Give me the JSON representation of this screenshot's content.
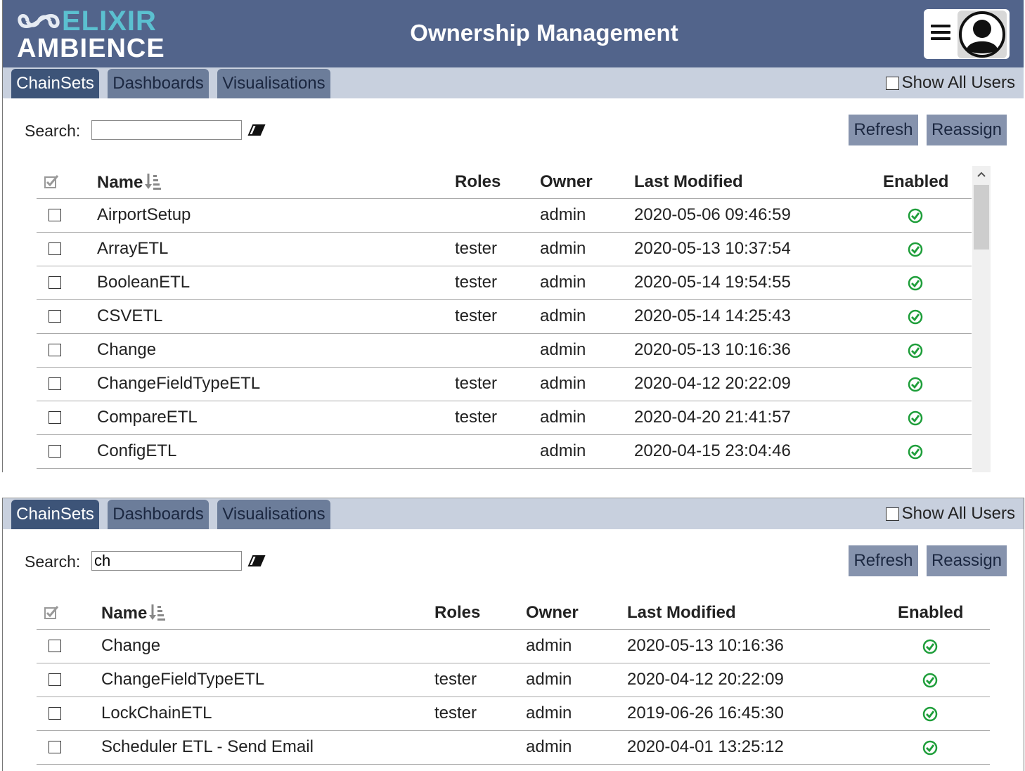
{
  "app": {
    "logo_top": "ELIXIR",
    "logo_bottom": "AMBIENCE",
    "title": "Ownership Management"
  },
  "views": [
    {
      "tabs": [
        "ChainSets",
        "Dashboards",
        "Visualisations"
      ],
      "active_tab": "ChainSets",
      "show_all_users_label": "Show All Users",
      "show_all_users_checked": false,
      "search_label": "Search:",
      "search_value": "",
      "refresh_label": "Refresh",
      "reassign_label": "Reassign",
      "columns": {
        "name": "Name",
        "roles": "Roles",
        "owner": "Owner",
        "last_modified": "Last Modified",
        "enabled": "Enabled"
      },
      "rows": [
        {
          "name": "AirportSetup",
          "roles": "",
          "owner": "admin",
          "last_modified": "2020-05-06 09:46:59",
          "enabled": true
        },
        {
          "name": "ArrayETL",
          "roles": "tester",
          "owner": "admin",
          "last_modified": "2020-05-13 10:37:54",
          "enabled": true
        },
        {
          "name": "BooleanETL",
          "roles": "tester",
          "owner": "admin",
          "last_modified": "2020-05-14 19:54:55",
          "enabled": true
        },
        {
          "name": "CSVETL",
          "roles": "tester",
          "owner": "admin",
          "last_modified": "2020-05-14 14:25:43",
          "enabled": true
        },
        {
          "name": "Change",
          "roles": "",
          "owner": "admin",
          "last_modified": "2020-05-13 10:16:36",
          "enabled": true
        },
        {
          "name": "ChangeFieldTypeETL",
          "roles": "tester",
          "owner": "admin",
          "last_modified": "2020-04-12 20:22:09",
          "enabled": true
        },
        {
          "name": "CompareETL",
          "roles": "tester",
          "owner": "admin",
          "last_modified": "2020-04-20 21:41:57",
          "enabled": true
        },
        {
          "name": "ConfigETL",
          "roles": "",
          "owner": "admin",
          "last_modified": "2020-04-15 23:04:46",
          "enabled": true
        }
      ]
    },
    {
      "tabs": [
        "ChainSets",
        "Dashboards",
        "Visualisations"
      ],
      "active_tab": "ChainSets",
      "show_all_users_label": "Show All Users",
      "show_all_users_checked": false,
      "search_label": "Search:",
      "search_value": "ch",
      "refresh_label": "Refresh",
      "reassign_label": "Reassign",
      "columns": {
        "name": "Name",
        "roles": "Roles",
        "owner": "Owner",
        "last_modified": "Last Modified",
        "enabled": "Enabled"
      },
      "rows": [
        {
          "name": "Change",
          "roles": "",
          "owner": "admin",
          "last_modified": "2020-05-13 10:16:36",
          "enabled": true
        },
        {
          "name": "ChangeFieldTypeETL",
          "roles": "tester",
          "owner": "admin",
          "last_modified": "2020-04-12 20:22:09",
          "enabled": true
        },
        {
          "name": "LockChainETL",
          "roles": "tester",
          "owner": "admin",
          "last_modified": "2019-06-26 16:45:30",
          "enabled": true
        },
        {
          "name": "Scheduler ETL - Send Email",
          "roles": "",
          "owner": "admin",
          "last_modified": "2020-04-01 13:25:12",
          "enabled": true
        }
      ]
    }
  ],
  "colors": {
    "header_bg": "#52648b",
    "tab_active": "#3d5478",
    "tab_inactive": "#6c7d9a",
    "tabbar_bg": "#c8d0de",
    "button_bg": "#8693ad",
    "enabled_green": "#1e9e3a",
    "logo_accent": "#5bc0d0"
  },
  "icons": {
    "menu": "hamburger-icon",
    "avatar": "user-avatar-icon",
    "clear": "eraser-icon",
    "sort": "sort-descending-icon",
    "select_all": "checkbox-checked-icon",
    "enabled": "check-circle-icon"
  }
}
